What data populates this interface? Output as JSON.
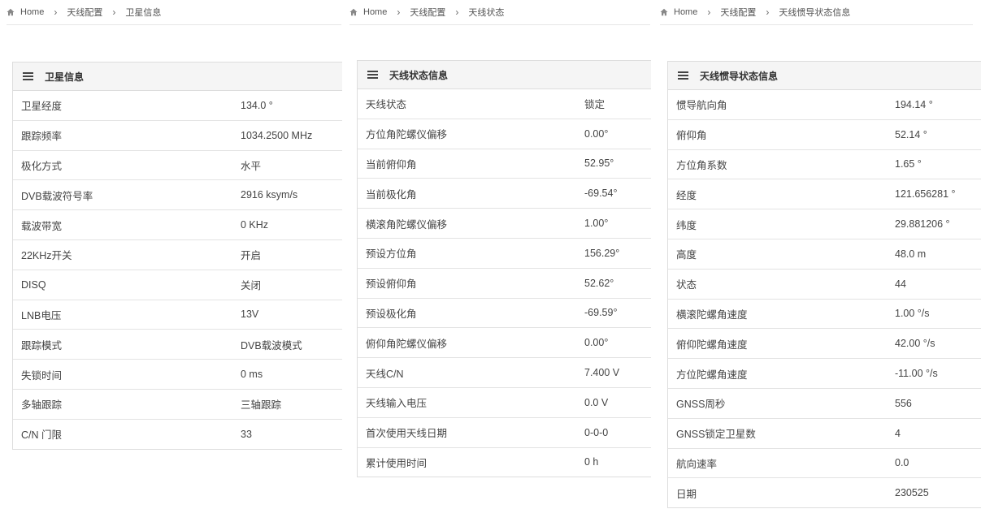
{
  "breadcrumbs": [
    [
      "Home",
      "天线配置",
      "卫星信息"
    ],
    [
      "Home",
      "天线配置",
      "天线状态"
    ],
    [
      "Home",
      "天线配置",
      "天线惯导状态信息"
    ]
  ],
  "panels": [
    {
      "title": "卫星信息",
      "rows": [
        {
          "label": "卫星经度",
          "value": "134.0 °"
        },
        {
          "label": "跟踪频率",
          "value": "1034.2500 MHz"
        },
        {
          "label": "极化方式",
          "value": "水平"
        },
        {
          "label": "DVB载波符号率",
          "value": "2916 ksym/s"
        },
        {
          "label": "载波带宽",
          "value": "0 KHz"
        },
        {
          "label": "22KHz开关",
          "value": "开启"
        },
        {
          "label": "DISQ",
          "value": "关闭"
        },
        {
          "label": "LNB电压",
          "value": "13V"
        },
        {
          "label": "跟踪模式",
          "value": "DVB载波模式"
        },
        {
          "label": "失锁时间",
          "value": "0 ms"
        },
        {
          "label": "多轴跟踪",
          "value": "三轴跟踪"
        },
        {
          "label": "C/N 门限",
          "value": "33"
        }
      ]
    },
    {
      "title": "天线状态信息",
      "rows": [
        {
          "label": "天线状态",
          "value": "锁定"
        },
        {
          "label": "方位角陀螺仪偏移",
          "value": "0.00°"
        },
        {
          "label": "当前俯仰角",
          "value": "52.95°"
        },
        {
          "label": "当前极化角",
          "value": "-69.54°"
        },
        {
          "label": "横滚角陀螺仪偏移",
          "value": "1.00°"
        },
        {
          "label": "预设方位角",
          "value": "156.29°"
        },
        {
          "label": "预设俯仰角",
          "value": "52.62°"
        },
        {
          "label": "预设极化角",
          "value": "-69.59°"
        },
        {
          "label": "俯仰角陀螺仪偏移",
          "value": "0.00°"
        },
        {
          "label": "天线C/N",
          "value": "7.400 V"
        },
        {
          "label": "天线输入电压",
          "value": "0.0 V"
        },
        {
          "label": "首次使用天线日期",
          "value": "0-0-0"
        },
        {
          "label": "累计使用时间",
          "value": "0 h"
        }
      ]
    },
    {
      "title": "天线惯导状态信息",
      "rows": [
        {
          "label": "惯导航向角",
          "value": "194.14 °"
        },
        {
          "label": "俯仰角",
          "value": "52.14 °"
        },
        {
          "label": "方位角系数",
          "value": "1.65 °"
        },
        {
          "label": "经度",
          "value": "121.656281 °"
        },
        {
          "label": "纬度",
          "value": "29.881206 °"
        },
        {
          "label": "高度",
          "value": "48.0 m"
        },
        {
          "label": "状态",
          "value": "44"
        },
        {
          "label": "横滚陀螺角速度",
          "value": "1.00 °/s"
        },
        {
          "label": "俯仰陀螺角速度",
          "value": "42.00 °/s"
        },
        {
          "label": "方位陀螺角速度",
          "value": "-11.00 °/s"
        },
        {
          "label": "GNSS周秒",
          "value": "556"
        },
        {
          "label": "GNSS锁定卫星数",
          "value": "4"
        },
        {
          "label": "航向速率",
          "value": "0.0"
        },
        {
          "label": "日期",
          "value": "230525"
        }
      ]
    }
  ],
  "icons": {
    "home": "home-icon",
    "menu": "menu-icon",
    "separator": "chevron-right-icon"
  },
  "colors": {
    "panel_header_bg": "#f5f5f5",
    "border": "#dddddd",
    "text": "#333333"
  }
}
